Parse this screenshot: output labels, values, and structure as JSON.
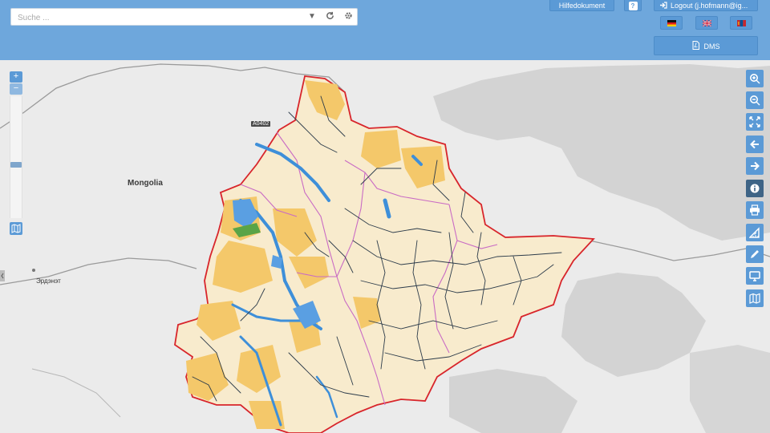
{
  "search": {
    "placeholder": "Suche ..."
  },
  "header": {
    "help_label": "Hilfedokument",
    "question_label": "?",
    "logout_label": "Logout (j.hofmann@ig...",
    "dms_label": "DMS"
  },
  "languages": [
    "de",
    "en",
    "mn"
  ],
  "map": {
    "zoom_in": "+",
    "zoom_out": "−",
    "labels": {
      "country": "Mongolia",
      "town": "Эрдэнэт",
      "road": "A0402"
    }
  },
  "toolbar": [
    "zoom-in",
    "zoom-out",
    "full-extent",
    "back",
    "forward",
    "info",
    "print",
    "measure",
    "draw",
    "display",
    "map-layers"
  ],
  "colors": {
    "header": "#6ea7dc",
    "button": "#5b9ad6",
    "active_tool": "#3e6486",
    "basin_border": "#d8252b",
    "sub_basin_border": "#c96bc4",
    "basin_fill": "#f8ebcd",
    "upland_fill": "#f4c86a",
    "river": "#3e8fd9",
    "river_line": "#2c3b4a",
    "forest": "#5aa447"
  }
}
